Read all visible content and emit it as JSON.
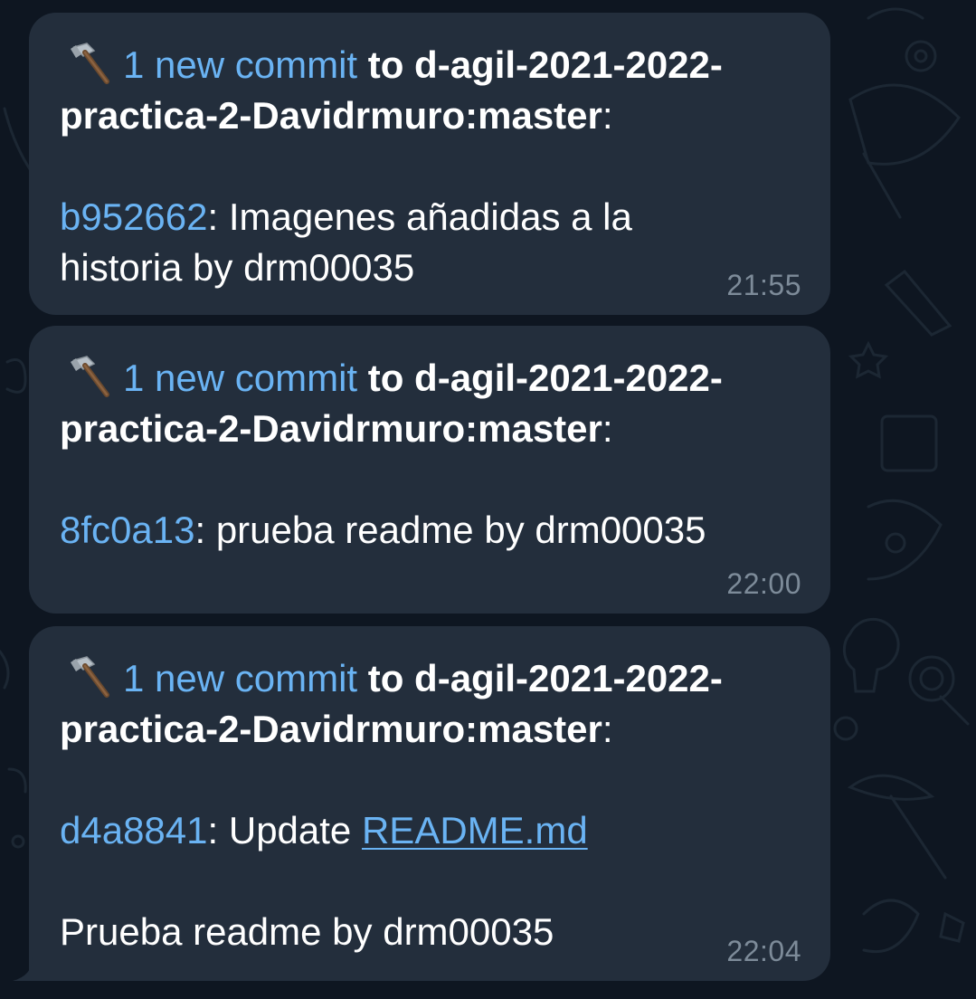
{
  "theme": {
    "background": "#0e1621",
    "bubble": "#232e3c",
    "accent": "#6ab3f3",
    "timestamp": "#7d8b99",
    "text": "#ffffff"
  },
  "messages": [
    {
      "icon": "hammer-icon",
      "commit_count": "1 new commit",
      "to_label": " to d-agil-2021-2022-",
      "repo_cont": "practica-2-Davidrmuro:master",
      "colon": ":",
      "hash": "b952662",
      "sep": ": ",
      "body_line1": "Imagenes añadidas a la",
      "body_line2": "historia by drm00035",
      "time": "21:55"
    },
    {
      "icon": "hammer-icon",
      "commit_count": "1 new commit",
      "to_label": " to d-agil-2021-2022-",
      "repo_cont": "practica-2-Davidrmuro:master",
      "colon": ":",
      "hash": "8fc0a13",
      "sep": ": ",
      "body_line1": "prueba readme by drm00035",
      "time": "22:00"
    },
    {
      "icon": "hammer-icon",
      "commit_count": "1 new commit",
      "to_label": " to d-agil-2021-2022-",
      "repo_cont": "practica-2-Davidrmuro:master",
      "colon": ":",
      "hash": "d4a8841",
      "sep": ": ",
      "update_text": "Update ",
      "file_link": "README.md",
      "description": "Prueba readme by drm00035",
      "time": "22:04"
    }
  ]
}
